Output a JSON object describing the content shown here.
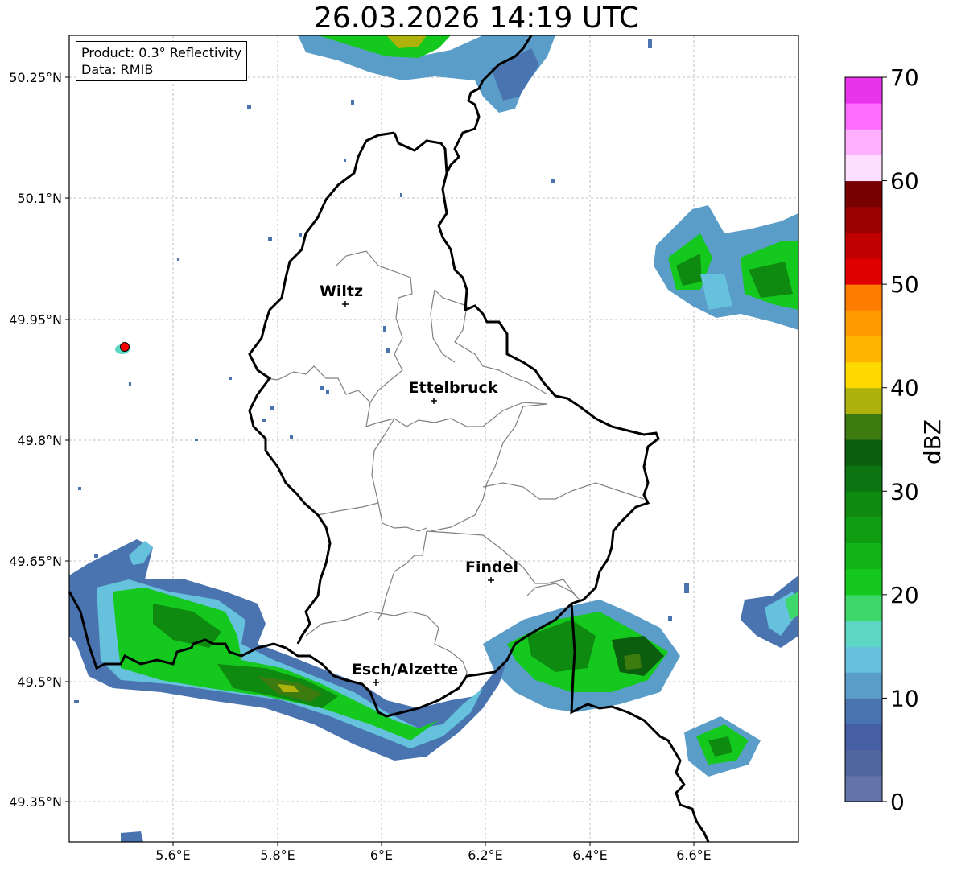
{
  "title": "26.03.2026 14:19 UTC",
  "info": {
    "product": "Product: 0.3° Reflectivity",
    "data": "Data: RMIB"
  },
  "lon_ticks": [
    "5.6°E",
    "5.8°E",
    "6°E",
    "6.2°E",
    "6.4°E",
    "6.6°E"
  ],
  "lat_ticks": [
    "50.25°N",
    "50.1°N",
    "49.95°N",
    "49.8°N",
    "49.65°N",
    "49.5°N",
    "49.35°N"
  ],
  "cities": [
    {
      "name": "Wiltz"
    },
    {
      "name": "Ettelbruck"
    },
    {
      "name": "Findel"
    },
    {
      "name": "Esch/Alzette"
    }
  ],
  "colorbar": {
    "label": "dBZ",
    "ticks": [
      "0",
      "10",
      "20",
      "30",
      "40",
      "50",
      "60",
      "70"
    ],
    "colors": [
      "#6274a8",
      "#51659e",
      "#455ea4",
      "#4a74b0",
      "#5a9dc9",
      "#66c2dc",
      "#5dd6c4",
      "#3dd76b",
      "#14c81e",
      "#12b517",
      "#0f9e12",
      "#0e8a10",
      "#0c7512",
      "#0b5e0d",
      "#3d7a10",
      "#adb20c",
      "#ffd800",
      "#ffb400",
      "#ff9a00",
      "#ff7c00",
      "#e00000",
      "#c00000",
      "#9b0000",
      "#780000",
      "#ffdfff",
      "#ffb0ff",
      "#ff6cff",
      "#ea34ec"
    ]
  },
  "legend_colors": {
    "border": "#000000",
    "districts": "#808080",
    "grid": "#b0b0b0",
    "radar_site": "#ff0000"
  }
}
